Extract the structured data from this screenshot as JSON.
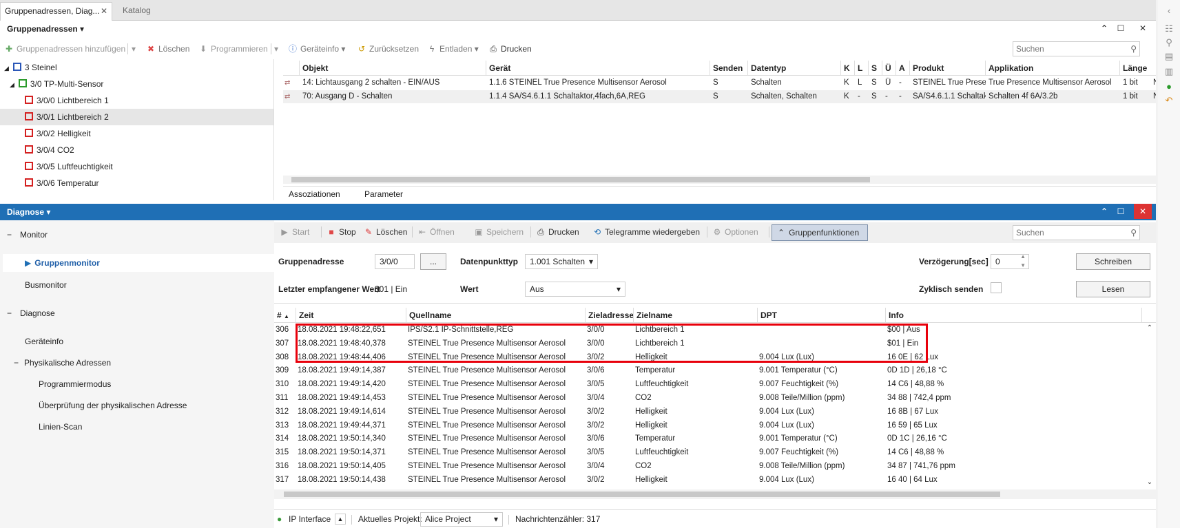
{
  "tabs": [
    {
      "label": "Gruppenadressen, Diag...",
      "close": "✕"
    },
    {
      "label": "Katalog"
    }
  ],
  "top_panel": {
    "title": "Gruppenadressen",
    "toolbar": {
      "add": "Gruppenadressen hinzufügen",
      "delete": "Löschen",
      "program": "Programmieren",
      "deviceinfo": "Geräteinfo",
      "reset": "Zurücksetzen",
      "unload": "Entladen",
      "print": "Drucken"
    },
    "search_placeholder": "Suchen",
    "tree": [
      {
        "label": "3 Steinel"
      },
      {
        "label": "3/0 TP-Multi-Sensor"
      },
      {
        "label": "3/0/0 Lichtbereich 1"
      },
      {
        "label": "3/0/1 Lichtbereich 2"
      },
      {
        "label": "3/0/2 Helligkeit"
      },
      {
        "label": "3/0/4 CO2"
      },
      {
        "label": "3/0/5 Luftfeuchtigkeit"
      },
      {
        "label": "3/0/6 Temperatur"
      }
    ],
    "columns": [
      "Objekt",
      "Gerät",
      "Senden",
      "Datentyp",
      "K",
      "L",
      "S",
      "Ü",
      "A",
      "Produkt",
      "Applikation",
      "Länge"
    ],
    "rows": [
      [
        "14: Lichtausgang 2 schalten - EIN/AUS",
        "1.1.6 STEINEL True Presence Multisensor Aerosol",
        "S",
        "Schalten",
        "K",
        "L",
        "S",
        "Ü",
        "-",
        "STEINEL True Prese...",
        "True Presence Multisensor Aerosol",
        "1 bit",
        "N"
      ],
      [
        "70: Ausgang D - Schalten",
        "1.1.4 SA/S4.6.1.1 Schaltaktor,4fach,6A,REG",
        "S",
        "Schalten, Schalten",
        "K",
        "-",
        "S",
        "-",
        "-",
        "SA/S4.6.1.1 Schaltak...",
        "Schalten 4f 6A/3.2b",
        "1 bit",
        "N"
      ]
    ],
    "bottom_tabs": [
      "Assoziationen",
      "Parameter"
    ]
  },
  "diag_panel": {
    "title": "Diagnose",
    "nav": {
      "monitor": "Monitor",
      "gruppenmonitor": "Gruppenmonitor",
      "busmonitor": "Busmonitor",
      "diagnose": "Diagnose",
      "geraeteinfo": "Geräteinfo",
      "phys": "Physikalische Adressen",
      "progmodus": "Programmiermodus",
      "ueberpruefung": "Überprüfung der physikalischen Adresse",
      "linienscan": "Linien-Scan"
    },
    "toolbar": {
      "start": "Start",
      "stop": "Stop",
      "clear": "Löschen",
      "open": "Öffnen",
      "save": "Speichern",
      "print": "Drucken",
      "replay": "Telegramme wiedergeben",
      "options": "Optionen",
      "groupfn": "Gruppenfunktionen"
    },
    "search_placeholder": "Suchen",
    "form": {
      "ga_label": "Gruppenadresse",
      "ga_value": "3/0/0",
      "ga_browse": "...",
      "dpt_label": "Datenpunkttyp",
      "dpt_value": "1.001 Schalten",
      "delay_label": "Verzögerung[sec]",
      "delay_value": "0",
      "write_btn": "Schreiben",
      "last_label": "Letzter empfangener Wert",
      "last_value": "$01 | Ein",
      "value_label": "Wert",
      "value_value": "Aus",
      "cyclic_label": "Zyklisch senden",
      "read_btn": "Lesen"
    },
    "columns": [
      "#",
      "Zeit",
      "Quellname",
      "Zieladresse",
      "Zielname",
      "DPT",
      "Info"
    ],
    "rows": [
      [
        "306",
        "18.08.2021 19:48:22,651",
        "IPS/S2.1 IP-Schnittstelle,REG",
        "3/0/0",
        "Lichtbereich 1",
        "",
        "$00 | Aus"
      ],
      [
        "307",
        "18.08.2021 19:48:40,378",
        "STEINEL True Presence Multisensor Aerosol",
        "3/0/0",
        "Lichtbereich 1",
        "",
        "$01 | Ein"
      ],
      [
        "308",
        "18.08.2021 19:48:44,406",
        "STEINEL True Presence Multisensor Aerosol",
        "3/0/2",
        "Helligkeit",
        "9.004 Lux (Lux)",
        "16 0E | 62 Lux"
      ],
      [
        "309",
        "18.08.2021 19:49:14,387",
        "STEINEL True Presence Multisensor Aerosol",
        "3/0/6",
        "Temperatur",
        "9.001 Temperatur (°C)",
        "0D 1D | 26,18 °C"
      ],
      [
        "310",
        "18.08.2021 19:49:14,420",
        "STEINEL True Presence Multisensor Aerosol",
        "3/0/5",
        "Luftfeuchtigkeit",
        "9.007 Feuchtigkeit (%)",
        "14 C6 | 48,88 %"
      ],
      [
        "311",
        "18.08.2021 19:49:14,453",
        "STEINEL True Presence Multisensor Aerosol",
        "3/0/4",
        "CO2",
        "9.008 Teile/Million (ppm)",
        "34 88 | 742,4 ppm"
      ],
      [
        "312",
        "18.08.2021 19:49:14,614",
        "STEINEL True Presence Multisensor Aerosol",
        "3/0/2",
        "Helligkeit",
        "9.004 Lux (Lux)",
        "16 8B | 67 Lux"
      ],
      [
        "313",
        "18.08.2021 19:49:44,371",
        "STEINEL True Presence Multisensor Aerosol",
        "3/0/2",
        "Helligkeit",
        "9.004 Lux (Lux)",
        "16 59 | 65 Lux"
      ],
      [
        "314",
        "18.08.2021 19:50:14,340",
        "STEINEL True Presence Multisensor Aerosol",
        "3/0/6",
        "Temperatur",
        "9.001 Temperatur (°C)",
        "0D 1C | 26,16 °C"
      ],
      [
        "315",
        "18.08.2021 19:50:14,371",
        "STEINEL True Presence Multisensor Aerosol",
        "3/0/5",
        "Luftfeuchtigkeit",
        "9.007 Feuchtigkeit (%)",
        "14 C6 | 48,88 %"
      ],
      [
        "316",
        "18.08.2021 19:50:14,405",
        "STEINEL True Presence Multisensor Aerosol",
        "3/0/4",
        "CO2",
        "9.008 Teile/Million (ppm)",
        "34 87 | 741,76 ppm"
      ],
      [
        "317",
        "18.08.2021 19:50:14,438",
        "STEINEL True Presence Multisensor Aerosol",
        "3/0/2",
        "Helligkeit",
        "9.004 Lux (Lux)",
        "16 40 | 64 Lux"
      ]
    ],
    "status": {
      "interface": "IP Interface",
      "project_label": "Aktuelles Projekt:",
      "project_value": "Alice Project",
      "counter": "Nachrichtenzähler: 317"
    }
  },
  "colors": {
    "diag_header": "#1f6fb5",
    "highlight_box": "#e8000b",
    "tree_icon_red": "#d42020",
    "tree_icon_green": "#2a9a2a",
    "tree_icon_blue": "#2b57b8"
  }
}
